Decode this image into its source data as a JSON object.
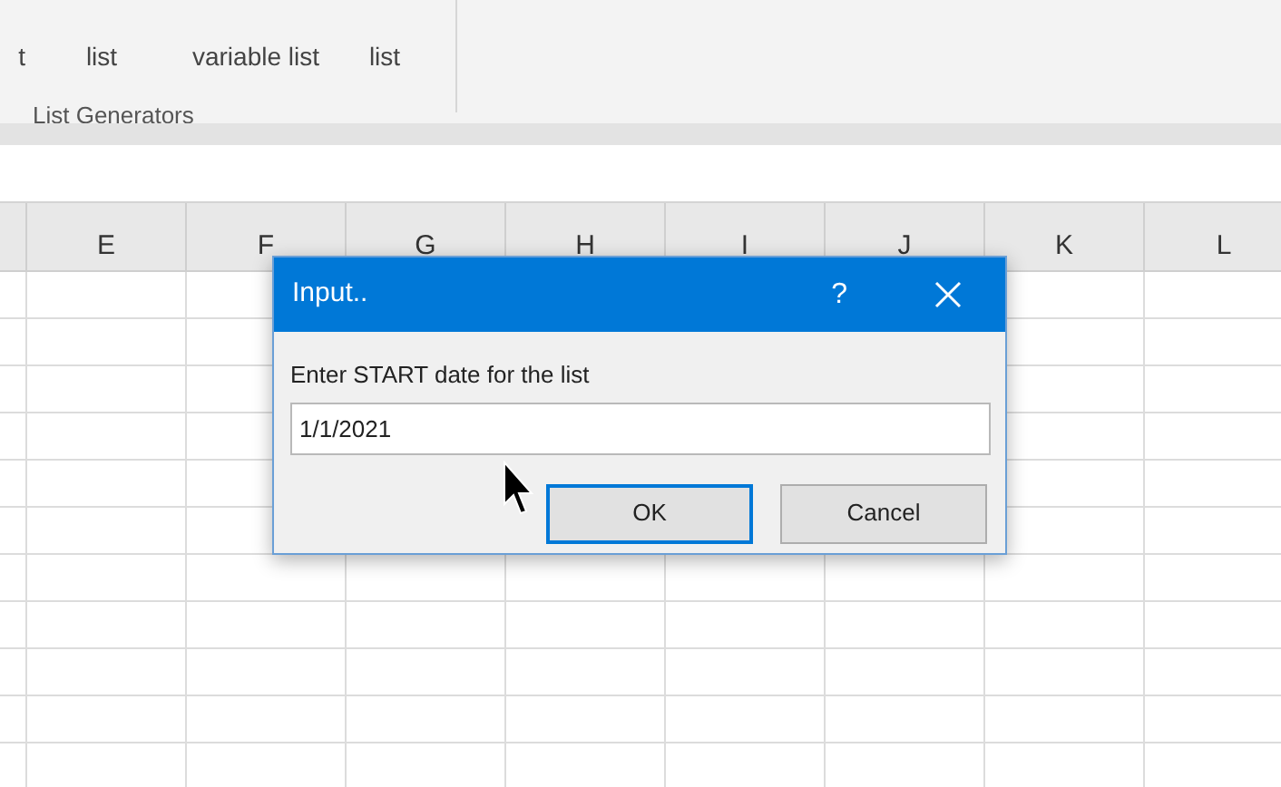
{
  "ribbon": {
    "buttons": [
      {
        "lines": [
          "t"
        ]
      },
      {
        "lines": [
          "list"
        ]
      },
      {
        "lines": [
          "variable list"
        ]
      },
      {
        "lines": [
          "list"
        ]
      }
    ],
    "group_label": "List Generators"
  },
  "sheet": {
    "column_headers": [
      "E",
      "F",
      "G",
      "H",
      "I",
      "J",
      "K",
      "L"
    ]
  },
  "dialog": {
    "title": "Input..",
    "help": "?",
    "prompt": "Enter START date for the list",
    "value": "1/1/2021",
    "buttons": [
      {
        "label": "OK",
        "focused": true
      },
      {
        "label": "Cancel",
        "focused": false
      }
    ]
  }
}
